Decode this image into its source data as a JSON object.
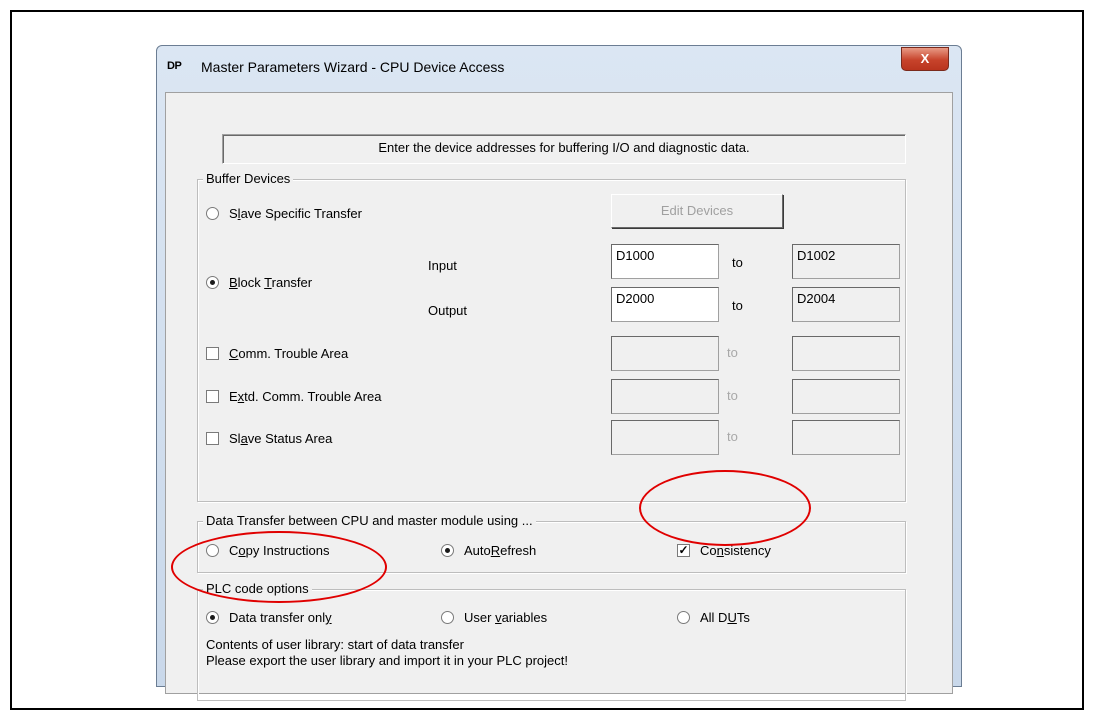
{
  "window": {
    "app_icon_text": "DP",
    "title": "Master Parameters Wizard - CPU Device Access",
    "close_label": "X"
  },
  "info_text": "Enter the device addresses for buffering I/O and diagnostic data.",
  "buffer_devices": {
    "legend": "Buffer Devices",
    "slave_specific": {
      "label": "Slave Specific Transfer",
      "selected": false
    },
    "edit_devices_label": "Edit Devices",
    "block_transfer": {
      "label": "Block Transfer",
      "selected": true
    },
    "input_label": "Input",
    "output_label": "Output",
    "to_label": "to",
    "input_from": "D1000",
    "input_to": "D1002",
    "output_from": "D2000",
    "output_to": "D2004",
    "comm_trouble": {
      "label": "Comm. Trouble Area",
      "checked": false,
      "from": "",
      "to": ""
    },
    "extd_comm_trouble": {
      "label": "Extd. Comm. Trouble Area",
      "checked": false,
      "from": "",
      "to": ""
    },
    "slave_status": {
      "label": "Slave Status Area",
      "checked": false,
      "from": "",
      "to": ""
    }
  },
  "data_transfer": {
    "legend": "Data Transfer between CPU and master module using ...",
    "copy_instructions": {
      "label": "Copy Instructions",
      "selected": false
    },
    "autorefresh": {
      "label": "AutoRefresh",
      "selected": true
    },
    "consistency": {
      "label": "Consistency",
      "checked": true
    }
  },
  "plc_code": {
    "legend": "PLC code options",
    "data_transfer_only": {
      "label": "Data transfer only",
      "selected": true
    },
    "user_variables": {
      "label": "User variables",
      "selected": false
    },
    "all_duts": {
      "label": "All DUTs",
      "selected": false
    },
    "note_line1": "Contents of user library: start of data transfer",
    "note_line2": "Please export the user library and import it in your PLC project!"
  },
  "colors": {
    "highlight_ellipse": "#e00000",
    "close_button": "#c7432b",
    "dialog_face": "#f0f0f0"
  }
}
